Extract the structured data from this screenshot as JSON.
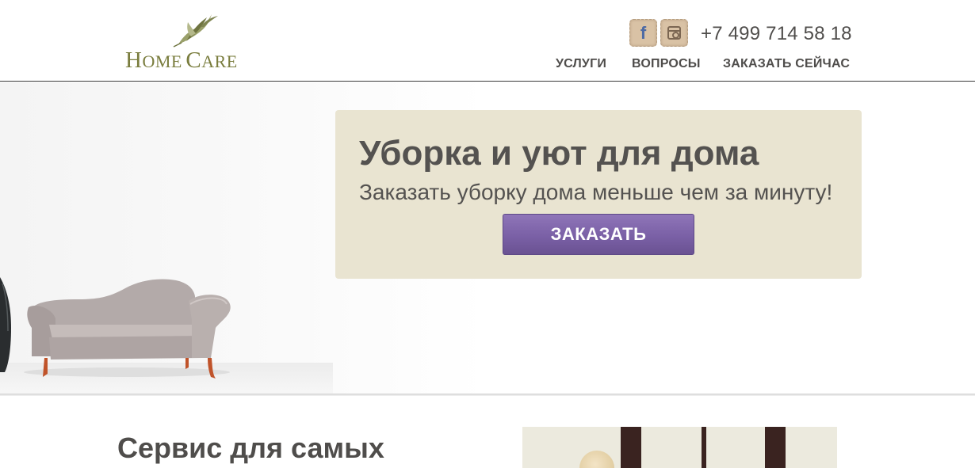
{
  "header": {
    "logo": {
      "text_big_1": "H",
      "text_small_1": "OME",
      "text_big_2": "C",
      "text_small_2": "ARE",
      "brand_color": "#7a7d3e"
    },
    "social": [
      {
        "name": "facebook",
        "icon": "facebook-icon",
        "glyph": "f"
      },
      {
        "name": "instagram",
        "icon": "instagram-icon"
      }
    ],
    "phone": "+7 499 714 58 18",
    "nav": [
      {
        "label": "УСЛУГИ"
      },
      {
        "label": "ВОПРОСЫ"
      },
      {
        "label": "ЗАКАЗАТЬ СЕЙЧАС"
      }
    ]
  },
  "hero": {
    "title": "Уборка и уют для дома",
    "subtitle": "Заказать уборку дома меньше чем за минуту!",
    "cta_label": "ЗАКАЗАТЬ",
    "cta_color": "#7b62a8",
    "panel_color": "#e9e4d1"
  },
  "section": {
    "title": "Сервис для самых"
  }
}
